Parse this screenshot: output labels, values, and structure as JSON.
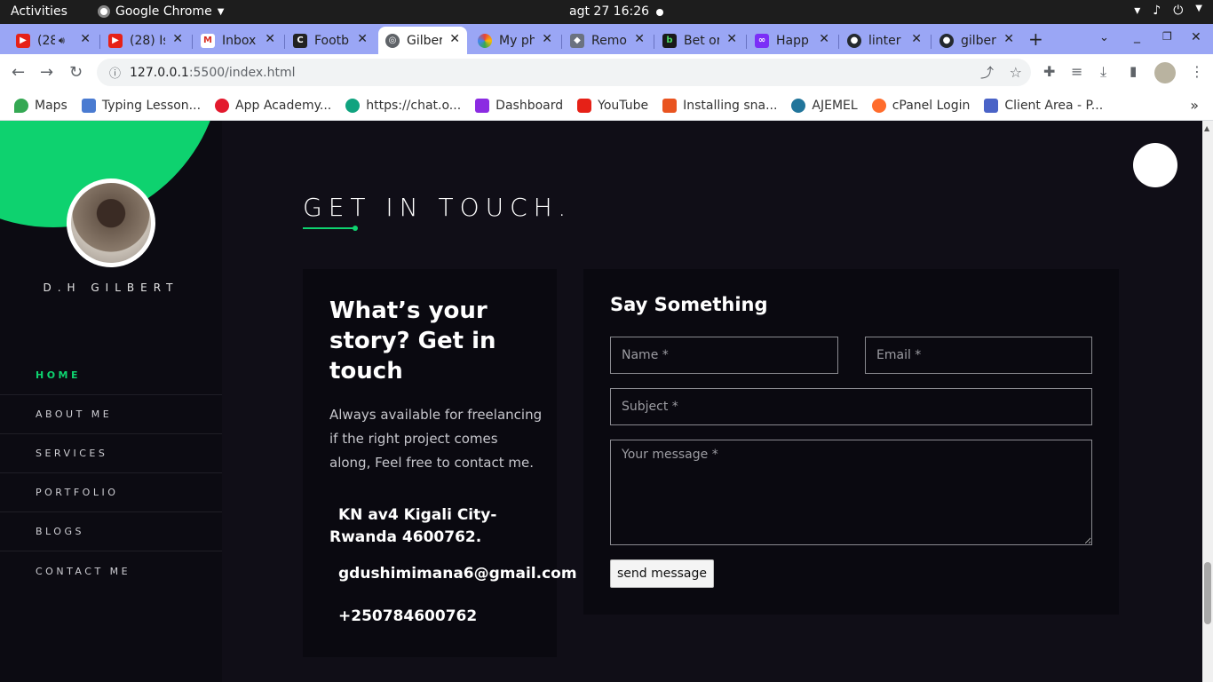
{
  "system_bar": {
    "activities": "Activities",
    "app_name": "Google Chrome",
    "clock": "agt 27  16:26"
  },
  "tabs": [
    {
      "title": "(28",
      "color": "#e62117"
    },
    {
      "title": "(28) Is",
      "color": "#e62117"
    },
    {
      "title": "Inbox",
      "color": "#d93025"
    },
    {
      "title": "Footb",
      "color": "#222222"
    },
    {
      "title": "Gilber",
      "color": "#5f6368",
      "active": true
    },
    {
      "title": "My ph",
      "color": "#fbbc04"
    },
    {
      "title": "Remo",
      "color": "#6b7280"
    },
    {
      "title": "Bet or",
      "color": "#1a1a1a"
    },
    {
      "title": "Happ",
      "color": "#7b2ff7"
    },
    {
      "title": "linter",
      "color": "#24292f"
    },
    {
      "title": "gilber",
      "color": "#24292f"
    }
  ],
  "address_bar": {
    "host": "127.0.0.1",
    "path": ":5500/index.html"
  },
  "bookmarks": [
    {
      "label": "Maps",
      "color": "#34a853"
    },
    {
      "label": "Typing Lesson...",
      "color": "#4a7bd1"
    },
    {
      "label": "App Academy...",
      "color": "#e3192d"
    },
    {
      "label": "https://chat.o...",
      "color": "#10a37f"
    },
    {
      "label": "Dashboard",
      "color": "#8b2be2"
    },
    {
      "label": "YouTube",
      "color": "#e62117"
    },
    {
      "label": "Installing sna...",
      "color": "#e95420"
    },
    {
      "label": "AJEMEL",
      "color": "#21759b"
    },
    {
      "label": "cPanel Login",
      "color": "#ff6c2c"
    },
    {
      "label": "Client Area - P...",
      "color": "#4a63c7"
    }
  ],
  "sidebar": {
    "name": "D.H GILBERT",
    "nav": [
      {
        "label": "HOME",
        "active": true
      },
      {
        "label": "ABOUT ME"
      },
      {
        "label": "SERVICES"
      },
      {
        "label": "PORTFOLIO"
      },
      {
        "label": "BLOGS"
      },
      {
        "label": "CONTACT ME"
      }
    ]
  },
  "contact": {
    "heading": "GET IN TOUCH.",
    "info": {
      "title": "What’s your story? Get in touch",
      "description": "Always available for freelancing if the right project comes along, Feel free to contact me.",
      "address": "KN av4 Kigali City-Rwanda 4600762.",
      "email": "gdushimimana6@gmail.com",
      "phone": "+250784600762"
    },
    "form": {
      "title": "Say Something",
      "name_placeholder": "Name *",
      "email_placeholder": "Email *",
      "subject_placeholder": "Subject *",
      "message_placeholder": "Your message *",
      "send_label": "send message"
    }
  },
  "colors": {
    "accent": "#0ed26f",
    "background": "#100e17",
    "tabstrip": "#9aa6f5"
  }
}
